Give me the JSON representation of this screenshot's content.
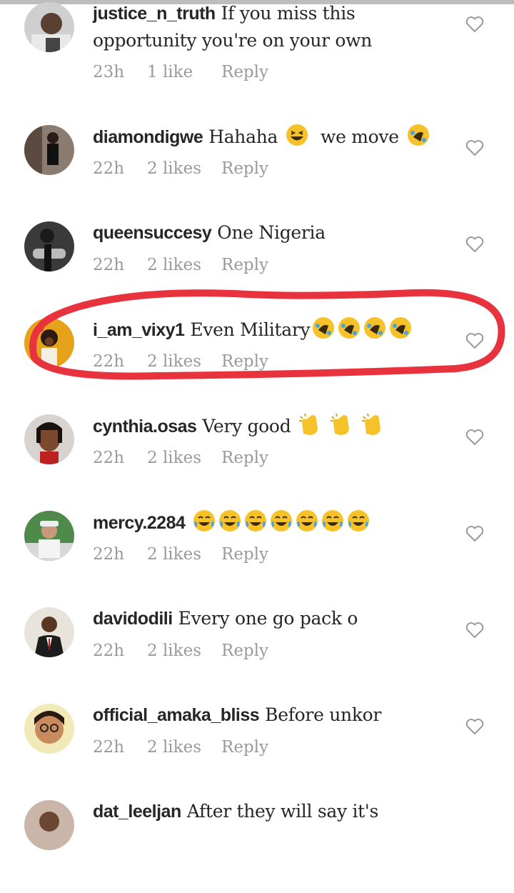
{
  "comments": [
    {
      "user": "justice_n_truth",
      "text": "If you miss this",
      "text2": "opportunity you're on your own",
      "emoji": "",
      "time": "23h",
      "likes": "1 like",
      "reply": "Reply"
    },
    {
      "user": "diamondigwe",
      "text": "Hahaha",
      "text2": "we move",
      "emoji": "laughing-squint-emoji, rofl-emoji",
      "time": "22h",
      "likes": "2 likes",
      "reply": "Reply"
    },
    {
      "user": "queensuccesy",
      "text": "One Nigeria",
      "emoji": "",
      "time": "22h",
      "likes": "2 likes",
      "reply": "Reply"
    },
    {
      "user": "i_am_vixy1",
      "text": "Even Military",
      "emoji": "rofl-emoji x4",
      "time": "22h",
      "likes": "2 likes",
      "reply": "Reply"
    },
    {
      "user": "cynthia.osas",
      "text": "Very good",
      "emoji": "clapping-hands-emoji x3",
      "time": "22h",
      "likes": "2 likes",
      "reply": "Reply"
    },
    {
      "user": "mercy.2284",
      "text": "",
      "emoji": "tears-of-joy-emoji x7",
      "time": "22h",
      "likes": "2 likes",
      "reply": "Reply"
    },
    {
      "user": "davidodili",
      "text": "Every one go pack o",
      "emoji": "",
      "time": "22h",
      "likes": "2 likes",
      "reply": "Reply"
    },
    {
      "user": "official_amaka_bliss",
      "text": "Before unkor",
      "emoji": "",
      "time": "22h",
      "likes": "2 likes",
      "reply": "Reply"
    },
    {
      "user": "dat_leeljan",
      "text": "After they will say it's",
      "emoji": "",
      "time": "",
      "likes": "",
      "reply": ""
    }
  ],
  "icons": {
    "like": "heart-outline-icon"
  },
  "colors": {
    "highlight": "#e8333f",
    "meta": "#9a9a9a",
    "text": "#262626"
  }
}
